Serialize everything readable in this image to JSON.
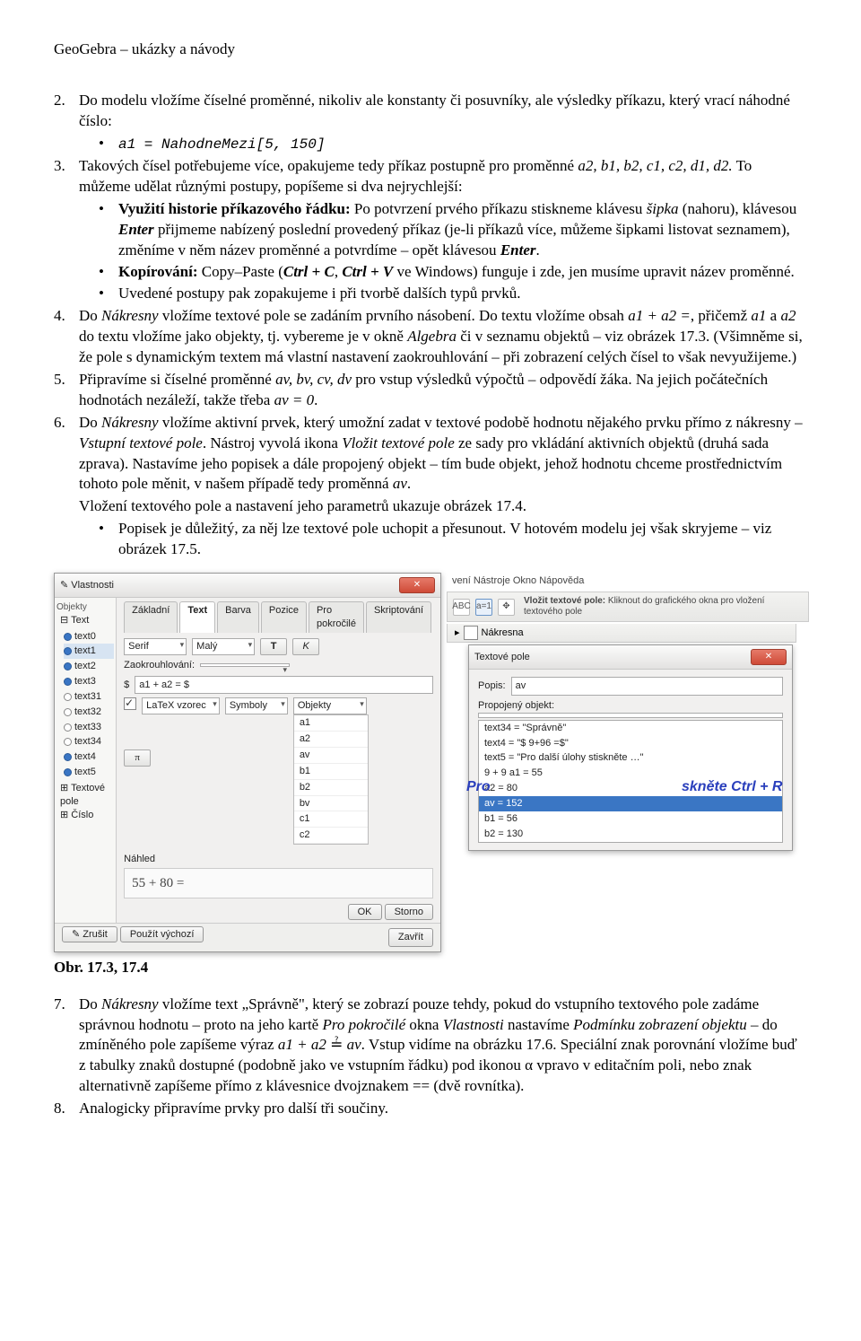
{
  "header": "GeoGebra – ukázky a návody",
  "items": [
    {
      "num": "2.",
      "body_a": "Do modelu vložíme číselné proměnné, nikoliv ale konstanty či posuvníky, ale výsledky příkazu, který vrací náhodné číslo:",
      "sub1_code": "a1 = NahodneMezi[5, 150]"
    },
    {
      "num": "3.",
      "body_a": "Takových čísel potřebujeme více, opakujeme tedy příkaz postupně pro proměnné ",
      "body_b_ital": "a2, b1, b2, c1, c2, d1, d2.",
      "body_c": " To můžeme udělat různými postupy, popíšeme si dva nejrychlejší:",
      "sub1_a_bold": "Využití historie příkazového řádku:",
      "sub1_b": " Po potvrzení prvého příkazu stiskneme klávesu ",
      "sub1_c_ital": "šipka",
      "sub1_d": " (nahoru), klávesou ",
      "sub1_e_bi": "Enter",
      "sub1_f": " přijmeme nabízený poslední provedený příkaz (je-li příkazů více, můžeme šipkami listovat seznamem), změníme v něm název proměnné a potvrdíme – opět klávesou ",
      "sub1_g_bi": "Enter",
      "sub1_h": ".",
      "sub2_a_bold": "Kopírování:",
      "sub2_b": " Copy–Paste (",
      "sub2_c_bi": "Ctrl + C",
      "sub2_d": ", ",
      "sub2_e_bi": "Ctrl + V",
      "sub2_f": " ve Windows) funguje i zde, jen musíme upravit název proměnné.",
      "sub3": "Uvedené postupy pak zopakujeme i při tvorbě dalších typů prvků."
    },
    {
      "num": "4.",
      "a": "Do ",
      "b_ital": "Nákresny",
      "c": " vložíme textové pole se zadáním prvního násobení. Do textu vložíme obsah ",
      "d_ital": "a1 + a2 =",
      "e": ", přičemž ",
      "f_ital": "a1",
      "g": " a ",
      "h_ital": "a2",
      "i": " do textu vložíme jako objekty, tj. vybereme je v okně ",
      "j_ital": "Algebra",
      "k": " či v seznamu objektů – viz obrázek 17.3. (Všimněme si, že pole s dynamickým textem má vlastní nastavení zaokrouhlování – při zobrazení celých čísel to však nevyužijeme.)"
    },
    {
      "num": "5.",
      "a": "Připravíme si číselné proměnné ",
      "b_ital": "av, bv, cv, dv",
      "c": " pro vstup výsledků výpočtů – odpovědí žáka. Na jejich počátečních hodnotách nezáleží, takže třeba ",
      "d_ital": "av = 0",
      "e": "."
    },
    {
      "num": "6.",
      "a": "Do ",
      "b_ital": "Nákresny",
      "c": " vložíme aktivní prvek, který umožní zadat v textové podobě hodnotu nějakého prvku přímo z nákresny – ",
      "d_ital": "Vstupní textové pole",
      "e": ". Nástroj vyvolá ikona ",
      "f_ital": "Vložit textové pole",
      "g": " ze sady pro vkládání aktivních objektů (druhá sada zprava). Nastavíme jeho popisek a dále propojený objekt – tím bude objekt, jehož hodnotu chceme prostřednictvím tohoto pole měnit, v našem případě tedy proměnná ",
      "h_ital": "av",
      "i": ".",
      "p2": "Vložení textového pole a nastavení jeho parametrů ukazuje obrázek 17.4.",
      "sub1": "Popisek je důležitý, za něj lze textové pole uchopit a přesunout. V hotovém modelu jej však skryjeme – viz obrázek 17.5."
    }
  ],
  "dlg1": {
    "title": "Vlastnosti",
    "objects_label": "Objekty",
    "tree_root": "Text",
    "tree_items": [
      "text0",
      "text1",
      "text2",
      "text3",
      "text31",
      "text32",
      "text33",
      "text34",
      "text4",
      "text5"
    ],
    "tree_root2": "Textové pole",
    "tree_root3": "Číslo",
    "tabs": [
      "Základní",
      "Text",
      "Barva",
      "Pozice",
      "Pro pokročilé",
      "Skriptování"
    ],
    "font_family": "Serif",
    "font_size": "Malý",
    "btn_bold": "T",
    "btn_ital": "K",
    "round_label": "Zaokrouhlování:",
    "expr_prefix": "$",
    "expr_value": "a1  + a2  = $",
    "latex_label": "LaTeX vzorec",
    "symbols_label": "Symboly",
    "objects_dd": "Objekty",
    "objlist": [
      "a1",
      "a2",
      "av",
      "b1",
      "b2",
      "bv",
      "c1",
      "c2"
    ],
    "pi": "π",
    "nahled_label": "Náhled",
    "nahled_value": "55 + 80 =",
    "btn_undo": "Zrušit",
    "btn_default": "Použít výchozí",
    "btn_ok": "OK",
    "btn_cancel": "Storno",
    "btn_close": "Zavřít",
    "close_x": "✕"
  },
  "tb2": {
    "menu": "vení  Nástroje  Okno  Nápověda",
    "hint_bold": "Vložit textové pole:",
    "hint_rest": " Kliknout do grafického okna pro vložení textového pole",
    "abc": "ABC",
    "a1": "a=1",
    "move": "✥",
    "nakresna": "Nákresna",
    "nav": "▸"
  },
  "dlg2": {
    "title": "Textové pole",
    "popis_label": "Popis:",
    "popis_value": "av",
    "linked_label": "Propojený objekt:",
    "rows": [
      "text34 = \"Správně\"",
      "text4 = \"$ 9+96 =$\"",
      "text5 = \"Pro další úlohy stiskněte …\"",
      "9 + 9 a1 = 55",
      "a2 = 80",
      "av = 152",
      "b1 = 56",
      "b2 = 130"
    ],
    "close_x": "✕"
  },
  "overlay_left": "Pro",
  "overlay_right": "skněte Ctrl + R",
  "caption": "Obr. 17.3, 17.4",
  "items2": [
    {
      "num": "7.",
      "a": "Do ",
      "b_ital": "Nákresny",
      "c": " vložíme text „Správně\", který se zobrazí pouze tehdy, pokud do vstupního textového pole zadáme správnou hodnotu – proto na jeho kartě ",
      "d_ital": "Pro pokročilé",
      "e": " okna ",
      "f_ital": "Vlastnosti",
      "g": " nastavíme ",
      "h_ital": "Podmínku zobrazení objektu",
      "i": " – do zmíněného pole zapíšeme výraz ",
      "j_ital": "a1 + a2 ",
      "j_eq": "≟",
      "j_ital2": " av",
      "k": ". Vstup vidíme na obrázku 17.6. Speciální znak porovnání vložíme buď z tabulky znaků dostupné (podobně jako ve vstupním řádku) pod ikonou α vpravo v editačním poli, nebo znak alternativně zapíšeme přímo z klávesnice dvojznakem == (dvě rovnítka)."
    },
    {
      "num": "8.",
      "a": "Analogicky připravíme prvky pro další tři součiny."
    }
  ]
}
